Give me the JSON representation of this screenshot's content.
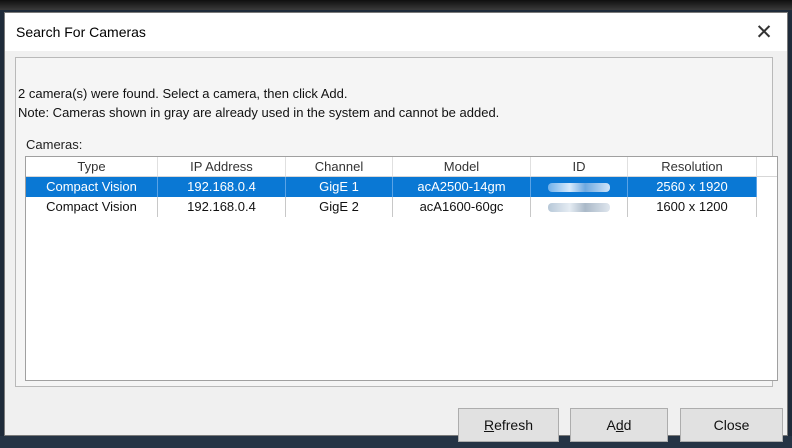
{
  "window": {
    "title": "Search For Cameras",
    "close_glyph": "✕"
  },
  "info": {
    "line1": "2 camera(s) were found.  Select a camera, then click Add.",
    "line2": "Note: Cameras shown in gray are already used in the system and cannot be added."
  },
  "cameras_label": "Cameras:",
  "table": {
    "columns": [
      "Type",
      "IP Address",
      "Channel",
      "Model",
      "ID",
      "Resolution"
    ],
    "rows": [
      {
        "type": "Compact Vision",
        "ip": "192.168.0.4",
        "channel": "GigE 1",
        "model": "acA2500-14gm",
        "id": "",
        "resolution": "2560 x 1920",
        "selected": true
      },
      {
        "type": "Compact Vision",
        "ip": "192.168.0.4",
        "channel": "GigE 2",
        "model": "acA1600-60gc",
        "id": "",
        "resolution": "1600 x 1200",
        "selected": false
      }
    ]
  },
  "buttons": {
    "refresh": {
      "mnemonic": "R",
      "rest": "efresh"
    },
    "add": {
      "pre": "A",
      "mnemonic": "d",
      "rest": "d"
    },
    "close": "Close"
  },
  "colors": {
    "selection": "#0a78d4",
    "dialog_bg": "#f0f0f0",
    "titlebar_bg": "#ffffff"
  },
  "icons": {
    "close": "close-icon",
    "redacted_id": "blurred-id-placeholder"
  }
}
